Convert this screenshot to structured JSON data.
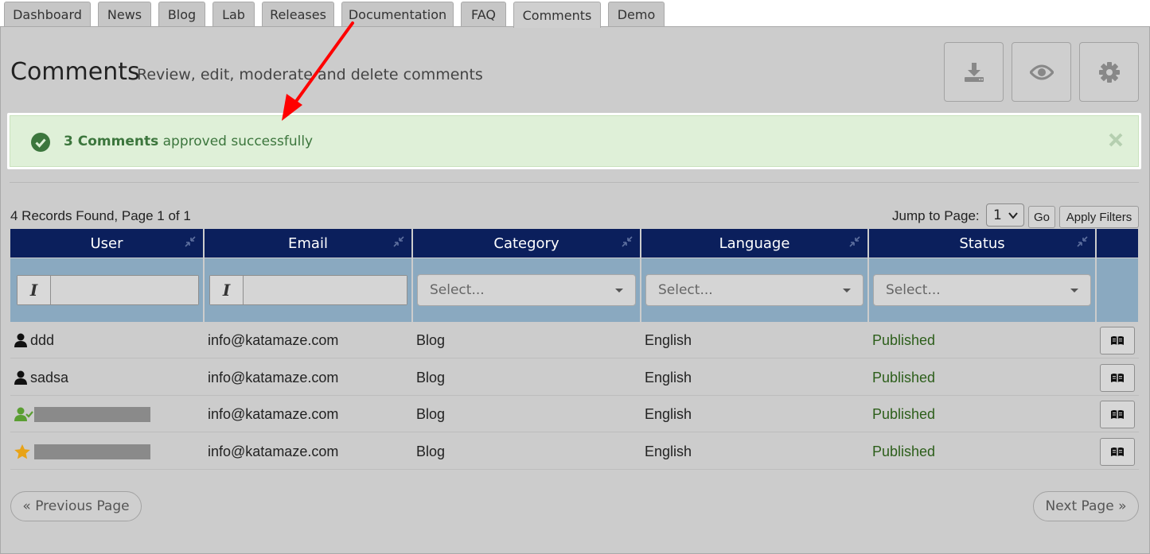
{
  "tabs": [
    "Dashboard",
    "News",
    "Blog",
    "Lab",
    "Releases",
    "Documentation",
    "FAQ",
    "Comments",
    "Demo"
  ],
  "active_tab": "Comments",
  "header": {
    "title": "Comments",
    "subtitle": "Review, edit, moderate and delete comments"
  },
  "toolbar": {
    "icons": [
      "download-icon",
      "eye-icon",
      "gear-icon"
    ]
  },
  "alert": {
    "bold_text": "3 Comments",
    "text": " approved successfully",
    "icon": "check-circle-icon"
  },
  "listing": {
    "records_text": "4 Records Found, Page 1 of 1",
    "jump_label": "Jump to Page:",
    "jump_value": "1",
    "go_label": "Go",
    "apply_filters_label": "Apply Filters"
  },
  "columns": [
    "User",
    "Email",
    "Category",
    "Language",
    "Status"
  ],
  "filters": {
    "italic_label": "I",
    "select_placeholder": "Select..."
  },
  "rows": [
    {
      "user": "ddd",
      "user_icon": "user-icon",
      "redacted": false,
      "email": "info@katamaze.com",
      "category": "Blog",
      "language": "English",
      "status": "Published"
    },
    {
      "user": "sadsa",
      "user_icon": "user-icon",
      "redacted": false,
      "email": "info@katamaze.com",
      "category": "Blog",
      "language": "English",
      "status": "Published"
    },
    {
      "user": "",
      "user_icon": "user-check-icon",
      "redacted": true,
      "email": "info@katamaze.com",
      "category": "Blog",
      "language": "English",
      "status": "Published"
    },
    {
      "user": "",
      "user_icon": "star-icon",
      "redacted": true,
      "email": "info@katamaze.com",
      "category": "Blog",
      "language": "English",
      "status": "Published"
    }
  ],
  "pagination": {
    "prev": "« Previous Page",
    "next": "Next Page »"
  },
  "colors": {
    "header_bg": "#0b1f5c",
    "filter_bg": "#8aa9c0",
    "alert_bg": "#dff0d8",
    "alert_text": "#3c763d",
    "status_text": "#2c5e1a",
    "annotation_arrow": "#ff0000"
  }
}
